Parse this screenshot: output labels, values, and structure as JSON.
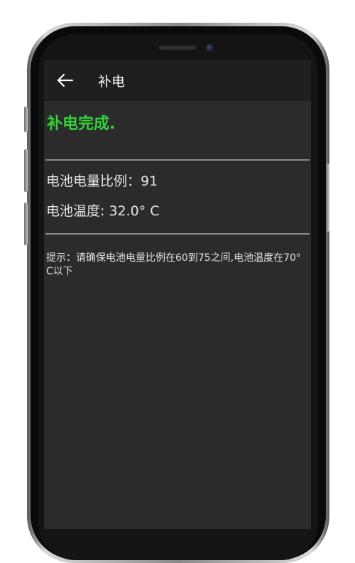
{
  "app_bar": {
    "back_icon": "arrow-left-icon",
    "title": "补电"
  },
  "status_text": "补电完成.",
  "status_color": "#34d13a",
  "battery": {
    "level_label": "电池电量比例：",
    "level_value": "91",
    "temp_label": "电池温度: ",
    "temp_value": "32.0° C"
  },
  "hint": "提示：请确保电池电量比例在60到75之间,电池温度在70° C以下"
}
